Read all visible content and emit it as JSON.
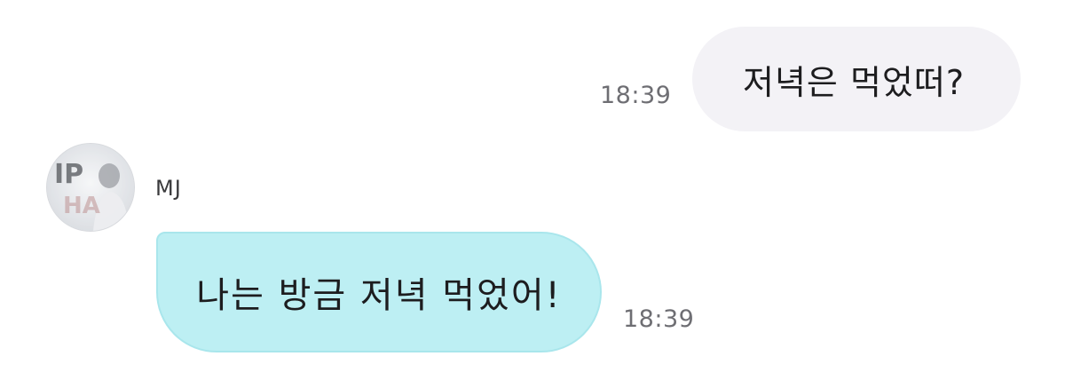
{
  "conversation": {
    "messages": [
      {
        "direction": "outgoing",
        "text": "저녁은 먹었떠?",
        "time": "18:39"
      },
      {
        "direction": "incoming",
        "sender": "MJ",
        "text": "나는 방금 저녁 먹었어!",
        "time": "18:39"
      }
    ]
  },
  "colors": {
    "outgoing_bubble": "#f3f2f6",
    "incoming_bubble": "#bdeff3",
    "timestamp": "#6e6e73"
  }
}
